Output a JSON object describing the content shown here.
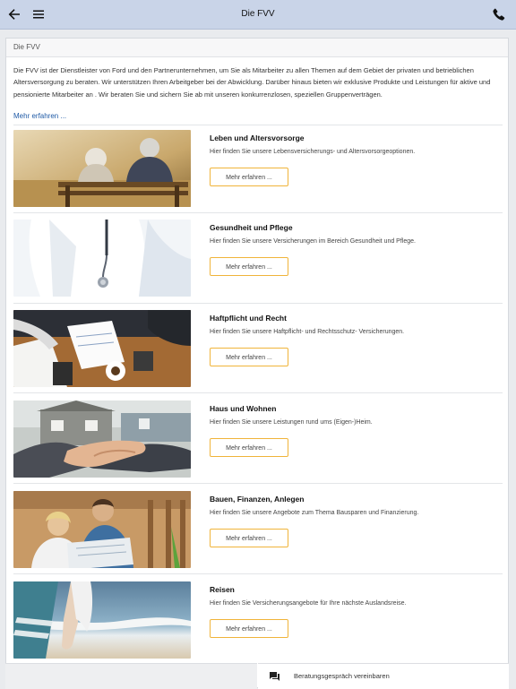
{
  "appbar": {
    "title": "Die FVV",
    "back_icon": "arrow-left-icon",
    "menu_icon": "hamburger-menu-icon",
    "phone_icon": "phone-icon"
  },
  "section": {
    "header": "Die FVV",
    "intro": "Die FVV ist der Dienstleister von Ford und den Partnerunternehmen, um Sie als Mitarbeiter zu allen Themen auf dem Gebiet der privaten und betrieblichen Altersversorgung zu beraten. Wir unterstützen Ihren Arbeitgeber bei der Abwicklung. Darüber hinaus bieten wir exklusive Produkte und Leistungen für aktive und pensionierte Mitarbeiter an . Wir beraten Sie und sichern Sie ab mit unseren konkurrenzlosen, speziellen Gruppenverträgen.",
    "more_link": "Mehr erfahren ..."
  },
  "items": [
    {
      "title": "Leben und Altersvorsorge",
      "desc": "Hier finden Sie unsere Lebensversicherungs- und Altersvorsorgeoptionen.",
      "button": "Mehr erfahren ...",
      "image": "elderly-couple-on-bench"
    },
    {
      "title": "Gesundheit und Pflege",
      "desc": "Hier finden Sie unsere Versicherungen im Bereich Gesundheit und Pflege.",
      "button": "Mehr erfahren ...",
      "image": "doctor-with-stethoscope"
    },
    {
      "title": "Haftpflicht und Recht",
      "desc": "Hier finden Sie unsere Haftpflicht- und Rechtsschutz- Versicherungen.",
      "button": "Mehr erfahren ...",
      "image": "meeting-with-documents"
    },
    {
      "title": "Haus und Wohnen",
      "desc": "Hier finden Sie unsere Leistungen rund ums (Eigen-)Heim.",
      "button": "Mehr erfahren ...",
      "image": "handshake-in-front-of-house"
    },
    {
      "title": "Bauen, Finanzen, Anlegen",
      "desc": "Hier finden Sie unsere Angebote zum Thema Bausparen und Finanzierung.",
      "button": "Mehr erfahren ...",
      "image": "couple-reading-plans"
    },
    {
      "title": "Reisen",
      "desc": "Hier finden Sie Versicherungsangebote für Ihre nächste Auslandsreise.",
      "button": "Mehr erfahren ...",
      "image": "beach-and-sea"
    }
  ],
  "bottombar": {
    "action_label": "Beratungsgespräch vereinbaren",
    "action_icon": "chat-bubbles-icon"
  },
  "colors": {
    "appbar": "#c9d4e8",
    "link": "#1f5aa6",
    "button_border": "#f0b43a"
  }
}
